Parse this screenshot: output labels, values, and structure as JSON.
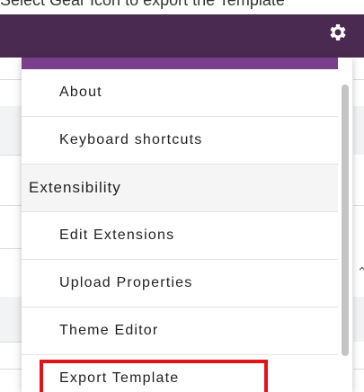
{
  "caption_text": "Select Gear Icon to export the Template",
  "header": {
    "settings_icon": "gear-icon",
    "bg_color": "#4b2a52"
  },
  "menu": {
    "accent_color": "#7a3f8c",
    "items": [
      {
        "label": "About",
        "type": "item"
      },
      {
        "label": "Keyboard shortcuts",
        "type": "item"
      },
      {
        "label": "Extensibility",
        "type": "section"
      },
      {
        "label": "Edit Extensions",
        "type": "item"
      },
      {
        "label": "Upload Properties",
        "type": "item"
      },
      {
        "label": "Theme Editor",
        "type": "item"
      },
      {
        "label": "Export Template",
        "type": "item",
        "highlighted": true
      }
    ],
    "highlight_color": "#e0151c"
  }
}
